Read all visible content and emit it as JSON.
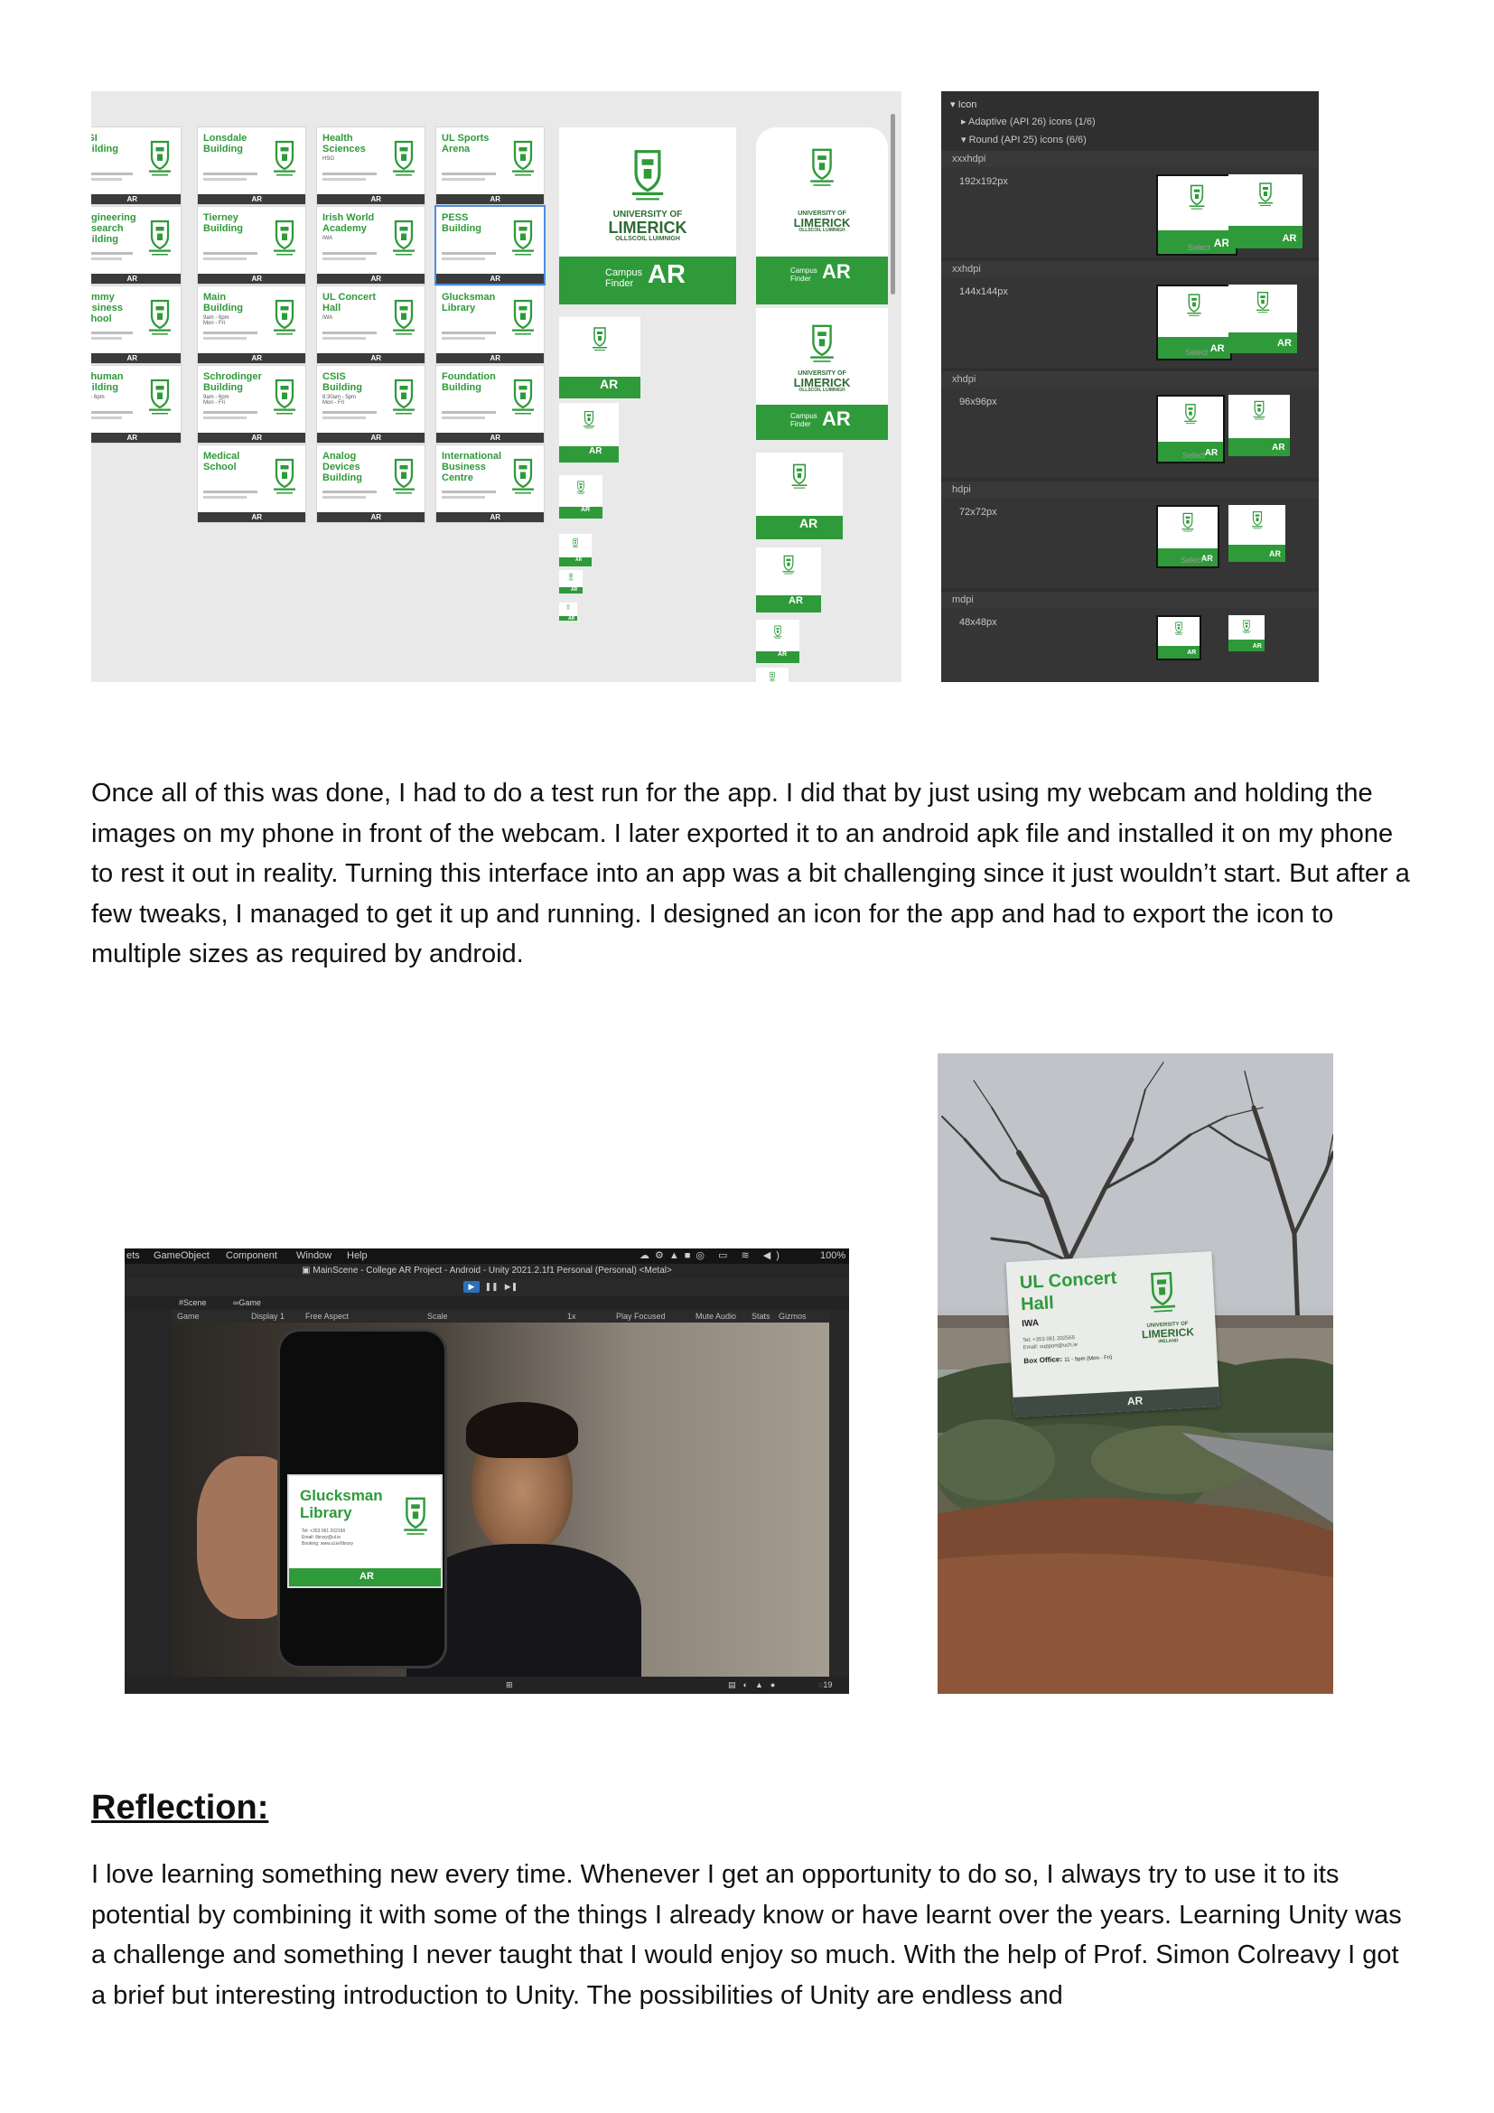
{
  "sheet": {
    "cards": [
      {
        "title": "ISSI\nBuilding",
        "sub": ""
      },
      {
        "title": "Lonsdale\nBuilding",
        "sub": ""
      },
      {
        "title": "Health\nSciences",
        "sub": "HSG"
      },
      {
        "title": "UL Sports\nArena",
        "sub": ""
      },
      {
        "title": "Engineering\nResearch\nBuilding",
        "sub": ""
      },
      {
        "title": "Tierney\nBuilding",
        "sub": ""
      },
      {
        "title": "Irish World\nAcademy",
        "sub": "IWA"
      },
      {
        "title": "PESS\nBuilding",
        "sub": ""
      },
      {
        "title": "Kemmy\nBusiness\nSchool",
        "sub": ""
      },
      {
        "title": "Main\nBuilding",
        "sub": "9am - 6pm\nMon - Fri"
      },
      {
        "title": "UL Concert\nHall",
        "sub": "IWA"
      },
      {
        "title": "Glucksman\nLibrary",
        "sub": ""
      },
      {
        "title": "Schuman\nBuilding",
        "sub": "9am - 6pm"
      },
      {
        "title": "Schrodinger\nBuilding",
        "sub": "9am - 6pm\nMon - Fri"
      },
      {
        "title": "CSIS\nBuilding",
        "sub": "8:30am - 5pm\nMon - Fri"
      },
      {
        "title": "Foundation\nBuilding",
        "sub": ""
      },
      {
        "title": "Medical\nSchool",
        "sub": ""
      },
      {
        "title": "Analog\nDevices\nBuilding",
        "sub": ""
      },
      {
        "title": "International\nBusiness\nCentre",
        "sub": ""
      }
    ],
    "card_bar_label": "AR",
    "icon": {
      "university": "UNIVERSITY OF",
      "limerick": "LIMERICK",
      "irish": "OLLSCOIL LUIMNIGH",
      "campus": "Campus",
      "finder": "Finder",
      "ar": "AR"
    }
  },
  "panel": {
    "header": "Icon",
    "adaptive": "Adaptive (API 26) icons (1/6)",
    "round": "Round (API 25) icons (6/6)",
    "select_label": "Select",
    "sections": [
      {
        "name": "xxxhdpi",
        "size": "192x192px"
      },
      {
        "name": "xxhdpi",
        "size": "144x144px"
      },
      {
        "name": "xhdpi",
        "size": "96x96px"
      },
      {
        "name": "hdpi",
        "size": "72x72px"
      },
      {
        "name": "mdpi",
        "size": "48x48px"
      }
    ],
    "slot_label": "AR"
  },
  "para1": "Once all of this was done, I had to do a test run for the app. I did that by just using my webcam and holding the images on my phone in front of the webcam. I later exported it to an android apk file and installed it on my phone to rest it out in reality. Turning this interface into an app was a bit challenging since it just wouldn’t start. But after a few tweaks, I managed to get it up and running. I designed an icon for the app and had to export the icon to multiple sizes as required by android.",
  "editor": {
    "menu": [
      "ets",
      "GameObject",
      "Component",
      "Window",
      "Help"
    ],
    "battery": "100%",
    "title": "MainScene - College AR Project - Android - Unity 2021.2.1f1 Personal (Personal) <Metal>",
    "tabs": [
      "Scene",
      "Game"
    ],
    "controls": [
      "Game",
      "Display 1",
      "Free Aspect",
      "Scale",
      "1x",
      "Play Focused",
      "Mute Audio",
      "Stats",
      "Gizmos"
    ],
    "phone_card_title": "Glucksman\nLibrary",
    "phone_card_ar": "AR",
    "phone_card_lines": [
      "Tel: +353 061 202166",
      "Email: library@ul.ie",
      "Booking: www.ul.ie/library"
    ],
    "bottom_count": "19"
  },
  "photo": {
    "card_title": "UL Concert\nHall",
    "card_sub": "IWA",
    "card_tel": "Tel: +353 061 202565",
    "card_email": "Email: support@uch.ie",
    "box_office": "Box Office:",
    "box_hours": "11 - 5pm (Mon - Fri)",
    "card_ar": "AR",
    "university": "UNIVERSITY OF",
    "limerick": "LIMERICK",
    "ireland": "IRELAND"
  },
  "reflection": {
    "heading": "Reflection:",
    "text": "I love learning something new every time. Whenever I get an opportunity to do so, I always try to use it to its potential by combining it with some of the things I already know or have learnt over the years. Learning Unity was a challenge and something I never taught that I would enjoy so much. With the help of Prof. Simon Colreavy I got a brief but interesting introduction to Unity. The possibilities of Unity are endless and"
  },
  "colors": {
    "ul_green": "#2e9a3a",
    "unity_dark": "#2f2f2f"
  }
}
